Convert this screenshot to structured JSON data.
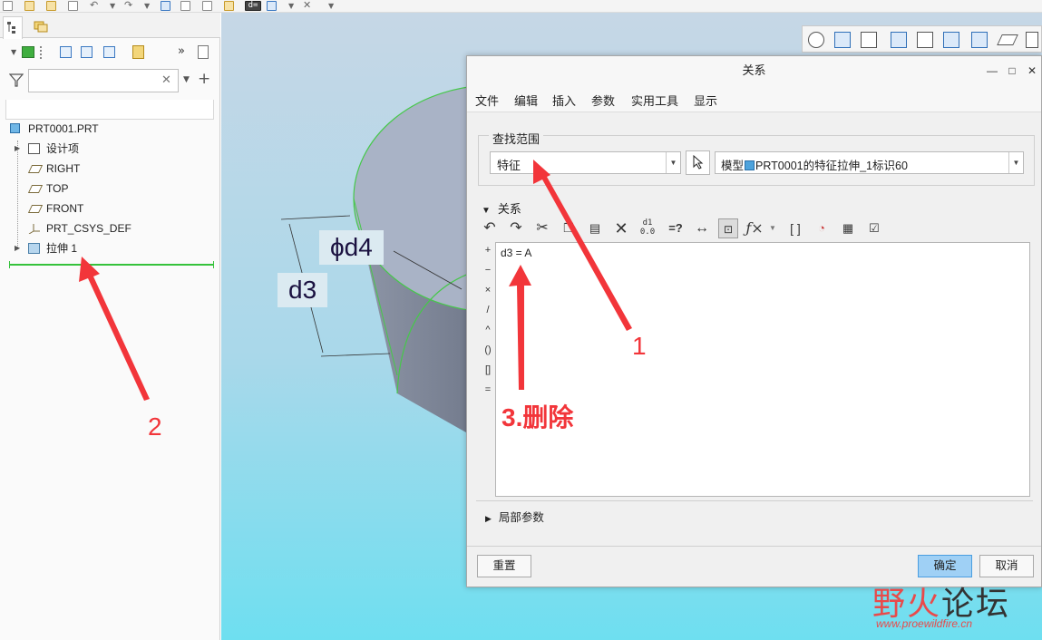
{
  "toolbar": {
    "icons": [
      "new-icon",
      "open-icon",
      "folder-icon",
      "save-icon",
      "undo-icon",
      "redo-icon",
      "regenerate-icon",
      "annotation-icon",
      "edit-icon",
      "print-icon",
      "dimension-icon",
      "window-icon",
      "close-window-icon"
    ],
    "dimension_label": "d="
  },
  "model_tree": {
    "filter": {
      "value": "",
      "placeholder": ""
    },
    "root": "PRT0001.PRT",
    "items": [
      {
        "label": "设计项",
        "icon": "design-items-icon",
        "expandable": true
      },
      {
        "label": "RIGHT",
        "icon": "datum-plane-icon",
        "expandable": false
      },
      {
        "label": "TOP",
        "icon": "datum-plane-icon",
        "expandable": false
      },
      {
        "label": "FRONT",
        "icon": "datum-plane-icon",
        "expandable": false
      },
      {
        "label": "PRT_CSYS_DEF",
        "icon": "csys-icon",
        "expandable": false
      },
      {
        "label": "拉伸 1",
        "icon": "extrude-icon",
        "expandable": true
      }
    ],
    "insert_line_color": "#35c23b"
  },
  "graphics": {
    "dimensions": {
      "d4": "ϕd4",
      "d3": "d3"
    },
    "cylinder_color": "#9aa4b4",
    "edge_color": "#46c84a"
  },
  "dialog": {
    "title": "关系",
    "menu": [
      "文件",
      "编辑",
      "插入",
      "参数",
      "实用工具",
      "显示"
    ],
    "scope": {
      "legend": "查找范围",
      "type": "特征",
      "model": "模型",
      "model_target": "PRT0001的特征拉伸_1标识60"
    },
    "relations_label": "关系",
    "operators": [
      "+",
      "−",
      "×",
      "/",
      "^",
      "()",
      "[]",
      "="
    ],
    "relations_text": "d3 = A",
    "local_params_label": "局部参数",
    "buttons": {
      "reset": "重置",
      "ok": "确定",
      "cancel": "取消"
    },
    "primary_color": "#9fd0f5"
  },
  "annotations": {
    "label_1": "1",
    "label_2": "2",
    "label_3": "3.删除",
    "color": "#f2353a"
  },
  "watermark": {
    "title_part1": "野火",
    "title_part2": "论坛",
    "url": "www.proewildfire.cn"
  }
}
